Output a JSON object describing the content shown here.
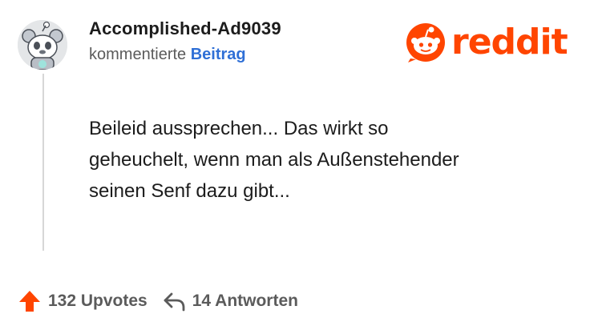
{
  "author": {
    "username": "Accomplished-Ad9039",
    "avatar_icon": "snoo-avatar-icon"
  },
  "meta": {
    "action_text": "kommentierte",
    "post_link": "Beitrag"
  },
  "brand": {
    "logo_icon": "reddit-snoo-icon",
    "wordmark": "reddit",
    "color": "#ff4500"
  },
  "comment": {
    "lines": [
      "Beileid aussprechen... Das wirkt so",
      "geheuchelt, wenn man als Außenstehender",
      "seinen Senf dazu gibt..."
    ]
  },
  "actions": {
    "upvotes": "132 Upvotes",
    "upvote_icon": "upvote-arrow-icon",
    "upvote_color": "#ff4500",
    "replies": "14 Antworten",
    "reply_icon": "reply-arrow-icon"
  }
}
